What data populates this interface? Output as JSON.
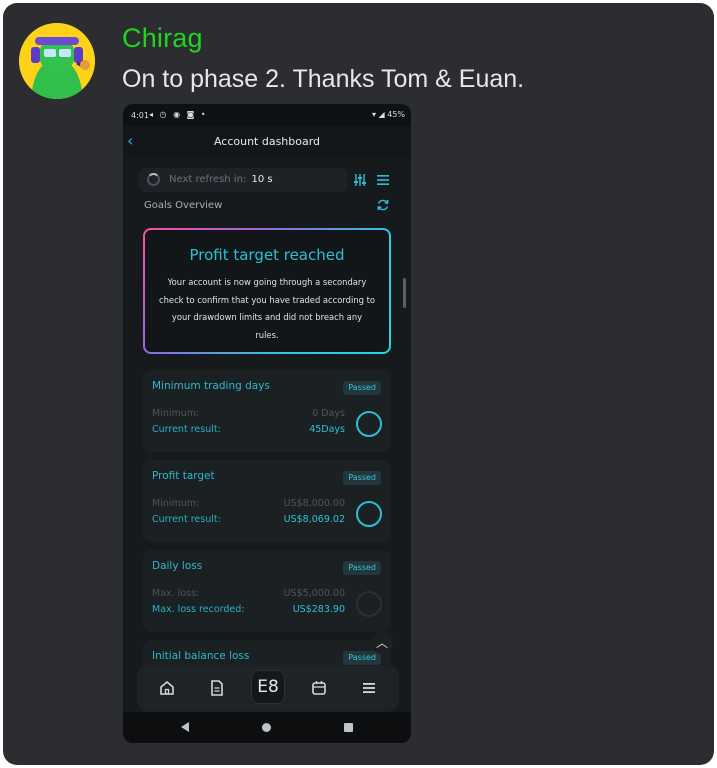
{
  "message": {
    "username": "Chirag",
    "text": "On to phase 2. Thanks Tom & Euan.",
    "username_color": "#1fd61f"
  },
  "phone": {
    "status_bar": {
      "time": "4:01",
      "battery": "45%"
    },
    "app_bar": {
      "title": "Account dashboard"
    },
    "refresh": {
      "label": "Next refresh in:",
      "value": "10 s"
    },
    "goals_title": "Goals Overview",
    "profit_banner": {
      "title": "Profit target reached",
      "body": "Your account is now going through a secondary check to confirm that you have traded according to your drawdown limits and did not breach any rules."
    },
    "goals": [
      {
        "name": "Minimum trading days",
        "status": "Passed",
        "row1_label": "Minimum:",
        "row1_value": "0 Days",
        "row2_label": "Current result:",
        "row2_value": "45Days"
      },
      {
        "name": "Profit target",
        "status": "Passed",
        "row1_label": "Minimum:",
        "row1_value": "US$8,000.00",
        "row2_label": "Current result:",
        "row2_value": "US$8,069.02"
      },
      {
        "name": "Daily loss",
        "status": "Passed",
        "row1_label": "Max. loss:",
        "row1_value": "US$5,000.00",
        "row2_label": "Max. loss recorded:",
        "row2_value": "US$283.90"
      },
      {
        "name": "Initial balance loss",
        "status": "Passed"
      }
    ],
    "bottom_nav": {
      "center_label": "E8"
    },
    "icons": [
      "back-icon",
      "spinner-icon",
      "filter-icon",
      "menu-icon",
      "sync-icon",
      "home-icon",
      "document-icon",
      "calendar-icon",
      "chevron-up-icon"
    ],
    "accent_color": "#2bc0d6"
  }
}
